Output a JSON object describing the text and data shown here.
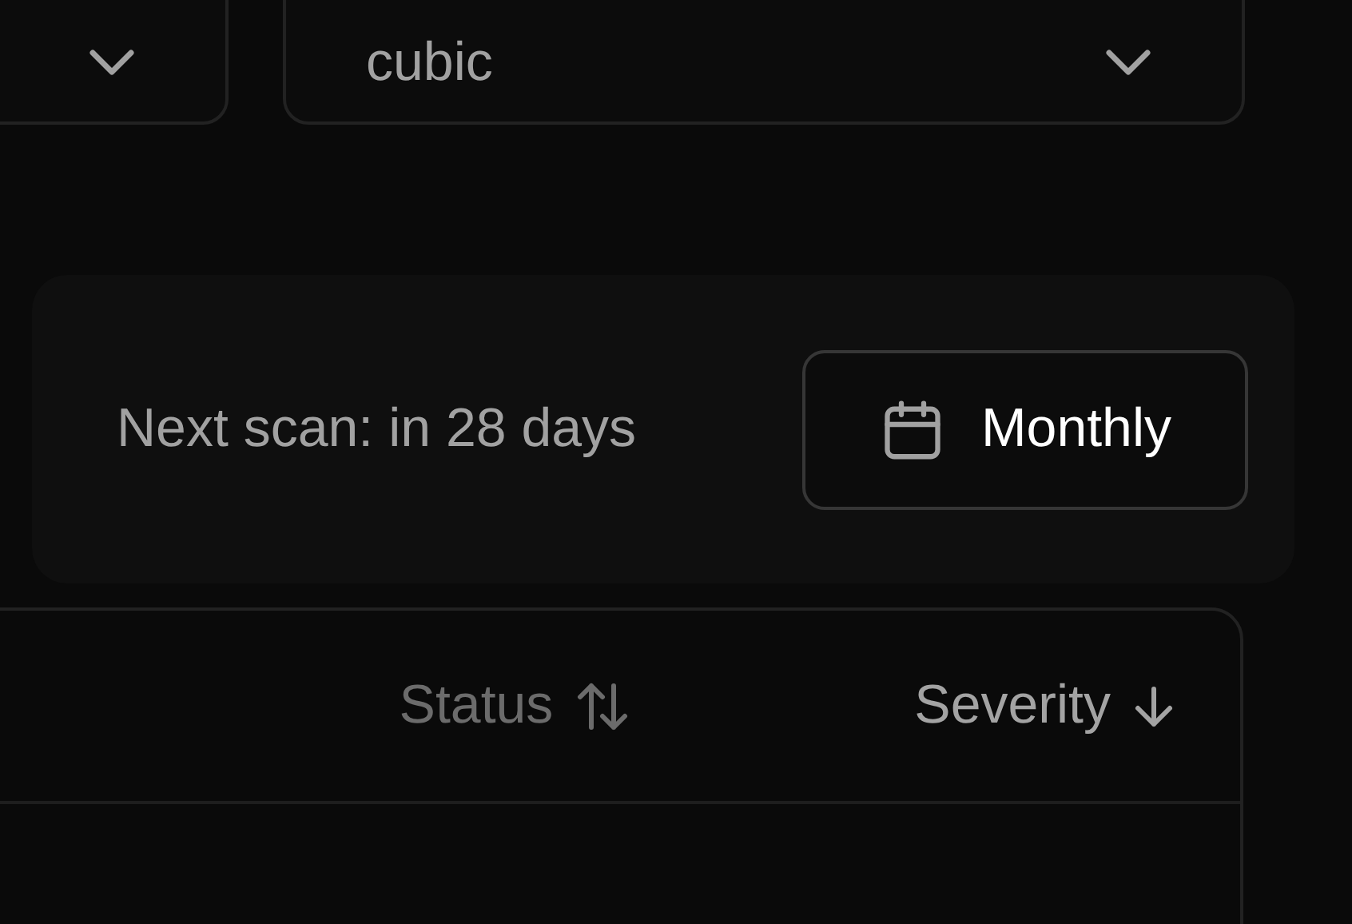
{
  "filters": [
    {
      "kind": "select"
    },
    {
      "kind": "select",
      "value": "cubic"
    }
  ],
  "schedule": {
    "next_scan": "Next scan: in 28 days",
    "frequency": "Monthly"
  },
  "table": {
    "columns": [
      {
        "label": "Status",
        "sorted": false
      },
      {
        "label": "Severity",
        "sorted": true
      }
    ]
  }
}
